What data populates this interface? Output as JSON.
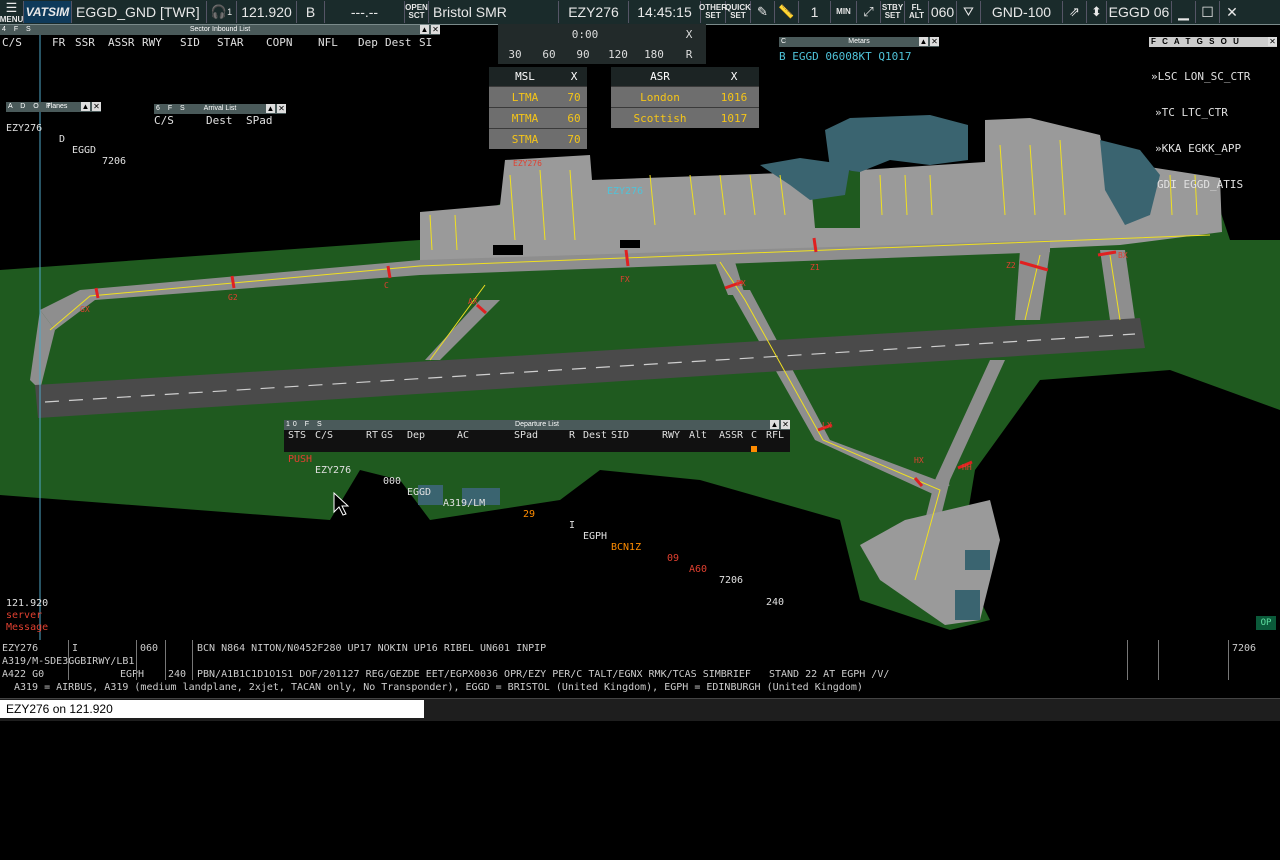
{
  "topbar": {
    "menu_label": "MENU",
    "logo": "VATSIM",
    "position": "EGGD_GND [TWR]",
    "frequency_count": "1",
    "frequency": "121.920",
    "atis_letter": "B",
    "freq_placeholder": "---.--",
    "open_sct_top": "OPEN",
    "open_sct_bottom": "SCT",
    "sector_name": "Bristol SMR",
    "selected_callsign": "EZY276",
    "utc_time": "14:45:15",
    "other_set_top": "OTHER",
    "other_set_bottom": "SET",
    "quick_set_top": "QUICK",
    "quick_set_bottom": "SET",
    "counter": "1",
    "min_label": "MIN",
    "stby_top": "STBY",
    "stby_bottom": "SET",
    "fl_top": "FL",
    "fl_bottom": "ALT",
    "fl_value": "060",
    "fl_filter": "GND-100",
    "airport_runway": "EGGD 06"
  },
  "sector_inbound": {
    "title": "Sector Inbound List",
    "flags": "4 F S",
    "columns": [
      "C/S",
      "FR",
      "SSR",
      "ASSR",
      "RWY",
      "SID",
      "STAR",
      "COPN",
      "NFL",
      "Dep",
      "Dest",
      "SI"
    ]
  },
  "planes_list": {
    "title": "Planes",
    "flags": "A D O T",
    "rows": [
      {
        "callsign": "EZY276",
        "type": "D",
        "dest": "EGGD",
        "squawk": "7206"
      }
    ]
  },
  "arrival_list": {
    "title": "Arrival List",
    "flags": "6 F S",
    "columns": [
      "C/S",
      "Dest",
      "SPad"
    ]
  },
  "timer": {
    "display": "0:00",
    "close": "X",
    "presets": [
      "30",
      "60",
      "90",
      "120",
      "180"
    ],
    "reset": "R"
  },
  "msl": {
    "title": "MSL",
    "close": "X",
    "rows": [
      {
        "name": "LTMA",
        "value": "70"
      },
      {
        "name": "MTMA",
        "value": "60"
      },
      {
        "name": "STMA",
        "value": "70"
      }
    ]
  },
  "asr": {
    "title": "ASR",
    "close": "X",
    "rows": [
      {
        "name": "London",
        "value": "1016"
      },
      {
        "name": "Scottish",
        "value": "1017"
      }
    ]
  },
  "metars": {
    "title": "Metars",
    "flag": "C",
    "text": "B EGGD 06008KT Q1017"
  },
  "atc_list": {
    "flags": "F C A T G S O U",
    "entries": [
      "»LSC LON_SC_CTR",
      "»TC LTC_CTR",
      "»KKA EGKK_APP",
      "GDI EGGD_ATIS"
    ]
  },
  "departure_list": {
    "title": "Departure List",
    "flags": "10 F S",
    "columns": [
      "STS",
      "C/S",
      "RT",
      "GS",
      "Dep",
      "AC",
      "SPad",
      "R",
      "Dest",
      "SID",
      "RWY",
      "Alt",
      "ASSR",
      "C",
      "RFL"
    ],
    "rows": [
      {
        "sts": "PUSH",
        "callsign": "EZY276",
        "gs": "000",
        "dep": "EGGD",
        "ac": "A319/LM",
        "spad": "29",
        "r": "I",
        "dest": "EGPH",
        "sid": "BCN1Z",
        "rwy": "09",
        "alt": "A60",
        "assr": "7206",
        "rfl": "240"
      }
    ]
  },
  "map_labels": {
    "aircraft_tag": "EZY276",
    "stand_tag": "EZY276",
    "taxiways": [
      "GX",
      "G2",
      "C",
      "FX",
      "Z1",
      "Z2",
      "BX",
      "AX",
      "EX",
      "LX",
      "HX",
      "HH"
    ]
  },
  "status": {
    "frequency": "121.920",
    "line2": "server",
    "line3": "Message",
    "op_badge": "OP"
  },
  "flight_plan": {
    "callsign": "EZY276",
    "rules": "I",
    "alt": "060",
    "route": "BCN N864 NITON/N0452F280 UP17 NOKIN UP16 RIBEL UN601 INPIP",
    "actype": "A319/M-SDE3GGBIRWY/LB1",
    "dest": "EGPH",
    "squawk": "7206",
    "line3_left": "A422 G0",
    "line3_rfl": "240",
    "remarks": "PBN/A1B1C1D1O1S1 DOF/201127 REG/GEZDE EET/EGPX0036 OPR/EZY PER/C TALT/EGNX RMK/TCAS SIMBRIEF   STAND 22 AT EGPH /V/",
    "decode": "A319 = AIRBUS, A319 (medium landplane, 2xjet, TACAN only, No Transponder), EGGD = BRISTOL (United Kingdom), EGPH = EDINBURGH (United Kingdom)"
  },
  "command_line": {
    "value": "EZY276 on 121.920"
  },
  "colors": {
    "grass": "#1f5a1f",
    "apron": "#9a9a9a",
    "taxiline": "#f0e020",
    "stopbar": "#e02020",
    "water_buildings": "#3a6470"
  }
}
